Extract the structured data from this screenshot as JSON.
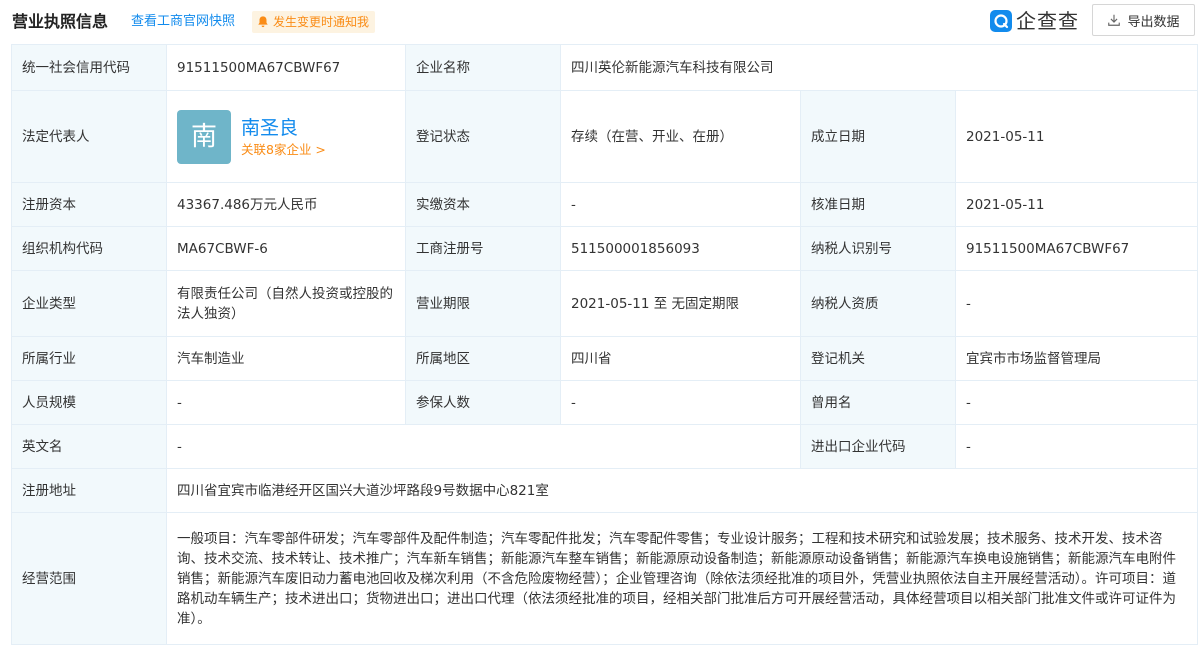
{
  "header": {
    "title": "营业执照信息",
    "snapshot_link": "查看工商官网快照",
    "notify_badge": "发生变更时通知我",
    "logo_text": "企查查",
    "export_label": "导出数据"
  },
  "labels": {
    "credit_code": "统一社会信用代码",
    "company_name": "企业名称",
    "legal_rep": "法定代表人",
    "reg_status": "登记状态",
    "established": "成立日期",
    "reg_capital": "注册资本",
    "paid_capital": "实缴资本",
    "approval_date": "核准日期",
    "org_code": "组织机构代码",
    "biz_reg_no": "工商注册号",
    "taxpayer_id": "纳税人识别号",
    "company_type": "企业类型",
    "biz_term": "营业期限",
    "taxpayer_qual": "纳税人资质",
    "industry": "所属行业",
    "region": "所属地区",
    "reg_authority": "登记机关",
    "staff_size": "人员规模",
    "insured": "参保人数",
    "former_name": "曾用名",
    "english_name": "英文名",
    "import_export_code": "进出口企业代码",
    "reg_address": "注册地址",
    "biz_scope": "经营范围"
  },
  "values": {
    "credit_code": "91511500MA67CBWF67",
    "company_name": "四川英伦新能源汽车科技有限公司",
    "legal_rep": {
      "avatar_char": "南",
      "name": "南圣良",
      "related": "关联8家企业 >"
    },
    "reg_status": "存续（在营、开业、在册）",
    "established": "2021-05-11",
    "reg_capital": "43367.486万元人民币",
    "paid_capital": "-",
    "approval_date": "2021-05-11",
    "org_code": "MA67CBWF-6",
    "biz_reg_no": "511500001856093",
    "taxpayer_id": "91511500MA67CBWF67",
    "company_type": "有限责任公司（自然人投资或控股的法人独资）",
    "biz_term": "2021-05-11 至 无固定期限",
    "taxpayer_qual": "-",
    "industry": "汽车制造业",
    "region": "四川省",
    "reg_authority": "宜宾市市场监督管理局",
    "staff_size": "-",
    "insured": "-",
    "former_name": "-",
    "english_name": "-",
    "import_export_code": "-",
    "reg_address": "四川省宜宾市临港经开区国兴大道沙坪路段9号数据中心821室",
    "biz_scope": "一般项目：汽车零部件研发；汽车零部件及配件制造；汽车零配件批发；汽车零配件零售；专业设计服务；工程和技术研究和试验发展；技术服务、技术开发、技术咨询、技术交流、技术转让、技术推广；汽车新车销售；新能源汽车整车销售；新能源原动设备制造；新能源原动设备销售；新能源汽车换电设施销售；新能源汽车电附件销售；新能源汽车废旧动力蓄电池回收及梯次利用（不含危险废物经营）；企业管理咨询（除依法须经批准的项目外，凭营业执照依法自主开展经营活动）。许可项目：道路机动车辆生产；技术进出口；货物进出口；进出口代理（依法须经批准的项目，经相关部门批准后方可开展经营活动，具体经营项目以相关部门批准文件或许可证件为准）。"
  },
  "colors": {
    "link_blue": "#128bed",
    "orange": "#fa8c16",
    "label_bg": "#f2f9fc",
    "border": "#e4eef6"
  }
}
